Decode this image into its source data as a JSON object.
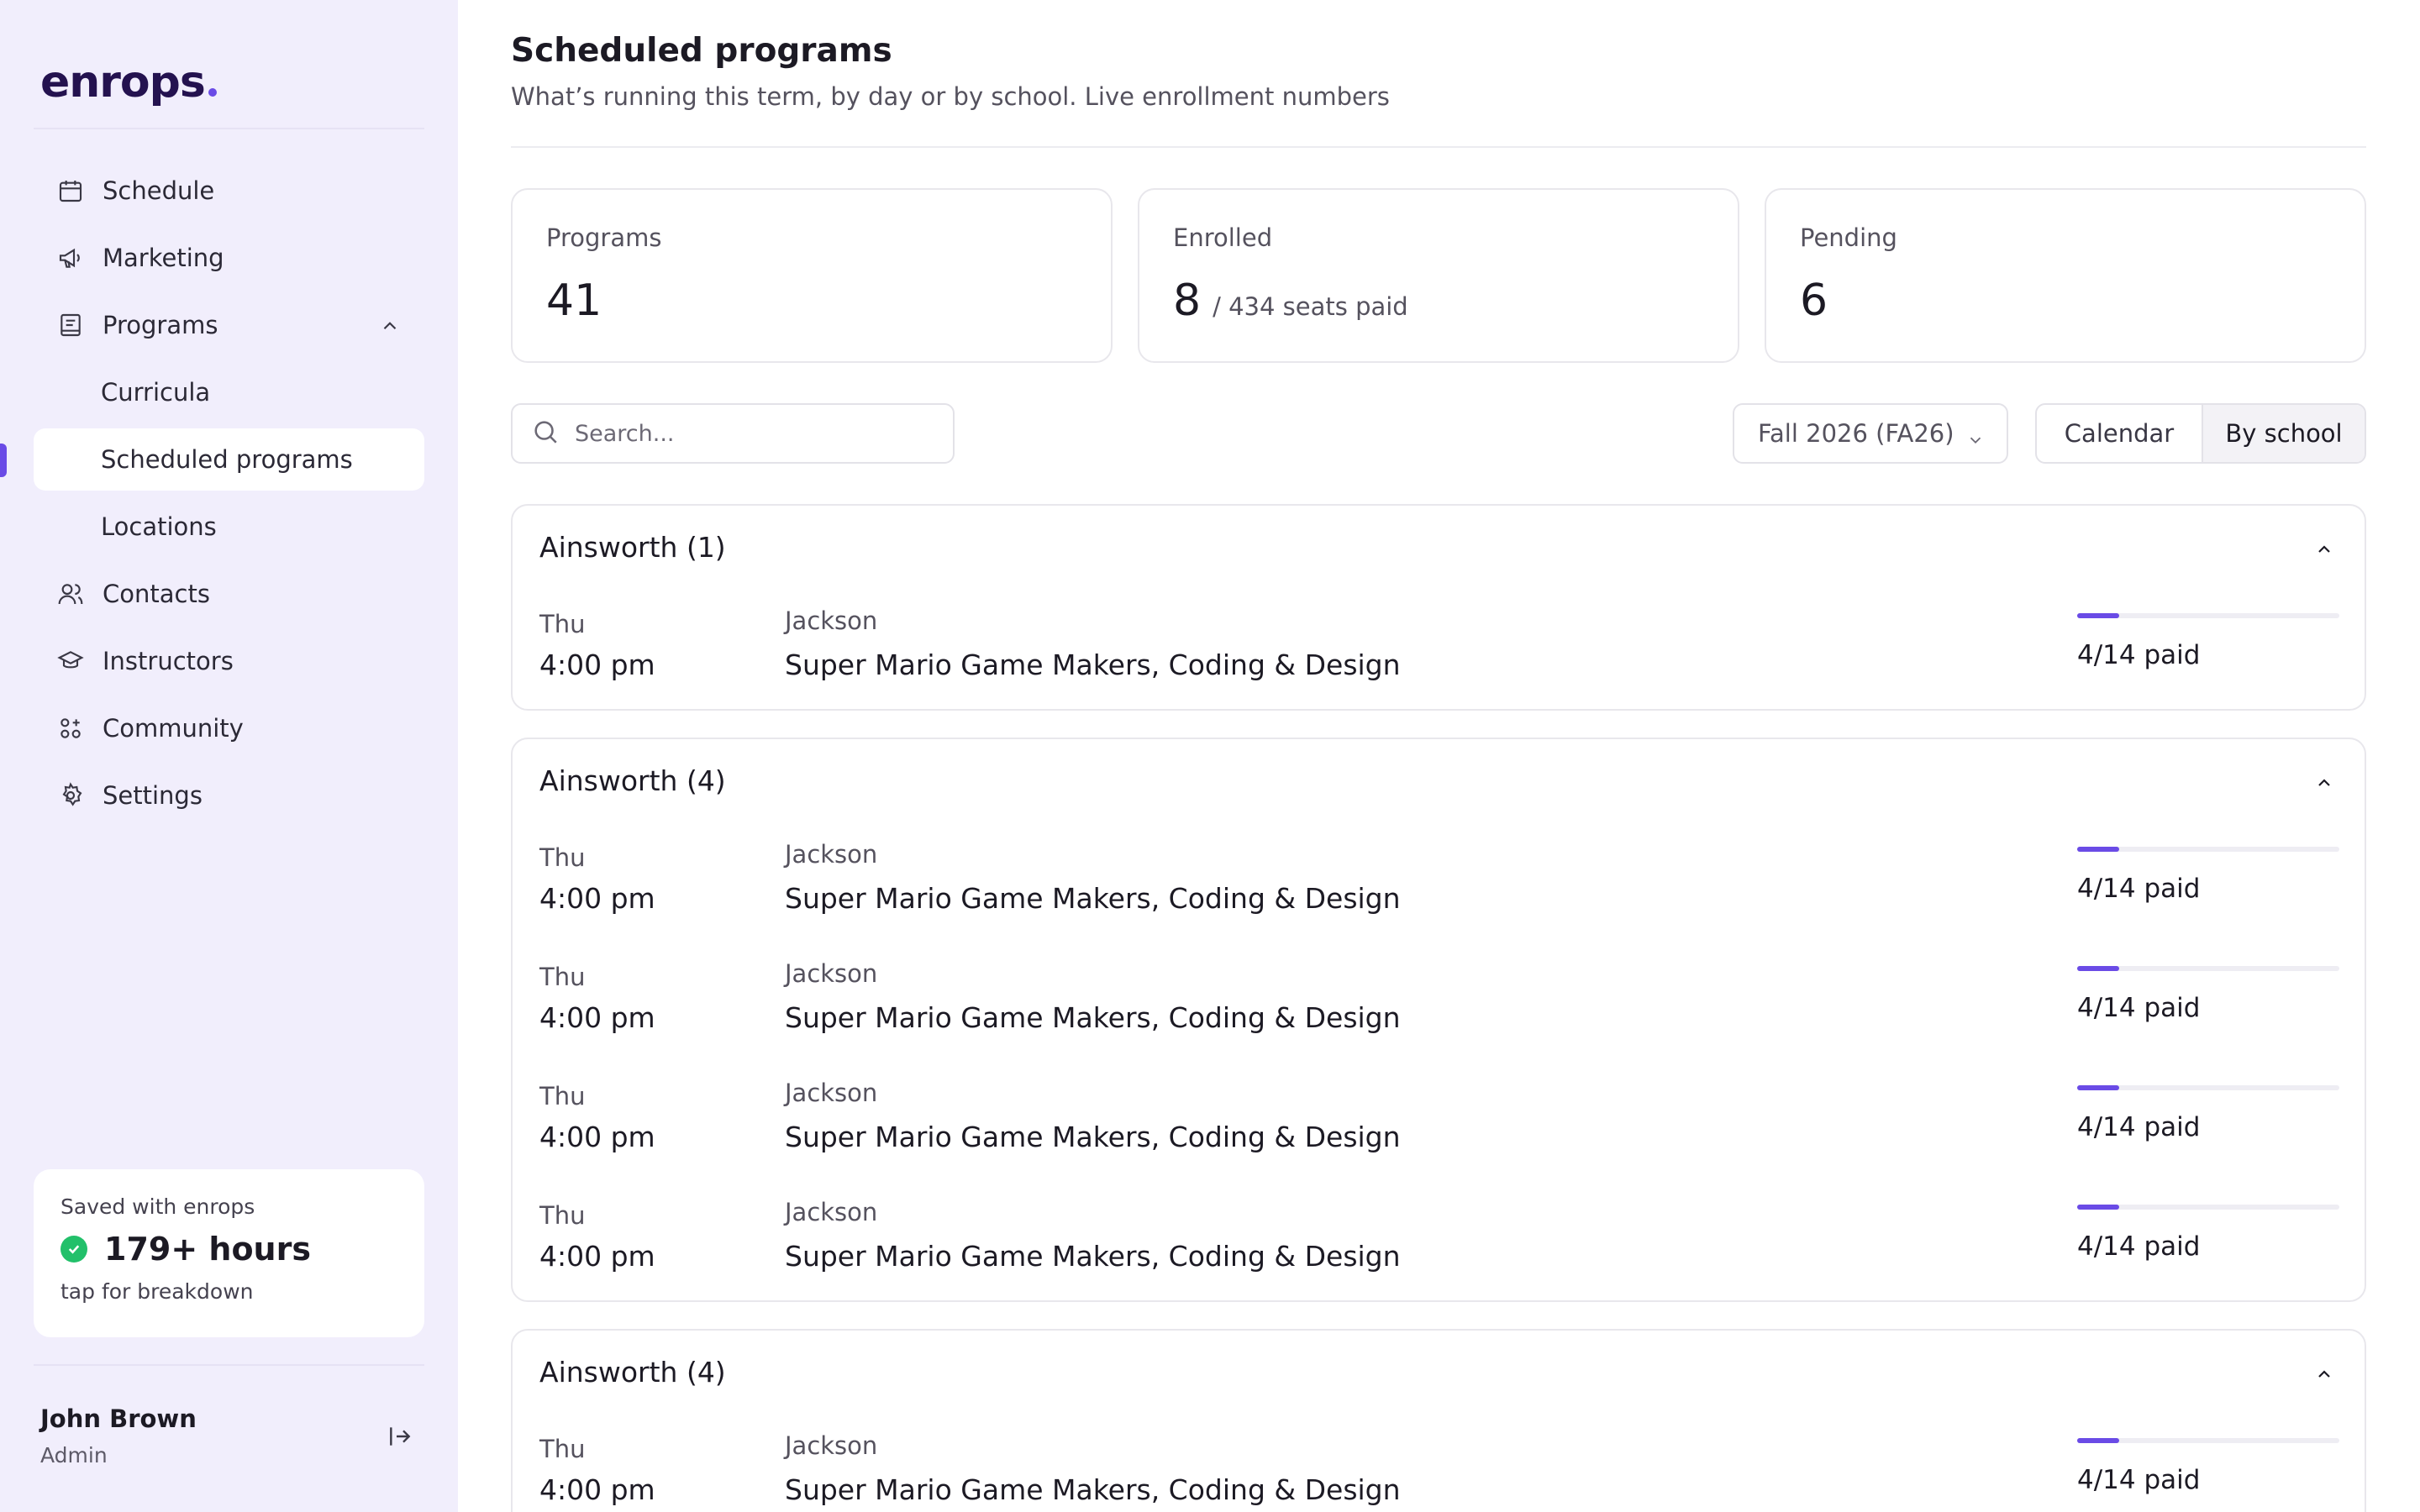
{
  "brand": {
    "name": "enrops",
    "accent": "#6a4be6"
  },
  "sidebar": {
    "nav": [
      {
        "label": "Schedule",
        "icon": "calendar-icon"
      },
      {
        "label": "Marketing",
        "icon": "megaphone-icon"
      },
      {
        "label": "Programs",
        "icon": "book-icon",
        "expanded": true
      },
      {
        "label": "Curricula",
        "sub": true
      },
      {
        "label": "Scheduled programs",
        "sub": true,
        "active": true
      },
      {
        "label": "Locations",
        "sub": true
      },
      {
        "label": "Contacts",
        "icon": "users-icon"
      },
      {
        "label": "Instructors",
        "icon": "graduation-cap-icon"
      },
      {
        "label": "Community",
        "icon": "community-icon"
      },
      {
        "label": "Settings",
        "icon": "gear-icon"
      }
    ],
    "saved": {
      "title": "Saved with enrops",
      "hours": "179+ hours",
      "sub": "tap for breakdown"
    },
    "user": {
      "name": "John Brown",
      "role": "Admin"
    }
  },
  "header": {
    "title": "Scheduled programs",
    "subtitle": "What’s running this term, by day or by school. Live enrollment numbers"
  },
  "stats": [
    {
      "label": "Programs",
      "value": "41",
      "suffix": ""
    },
    {
      "label": "Enrolled",
      "value": "8",
      "suffix": "/ 434 seats paid"
    },
    {
      "label": "Pending",
      "value": "6",
      "suffix": ""
    }
  ],
  "toolbar": {
    "search_placeholder": "Search...",
    "term": "Fall 2026 (FA26)",
    "views": {
      "calendar": "Calendar",
      "by_school": "By school",
      "active": "by_school"
    }
  },
  "groups": [
    {
      "title": "Ainsworth (1)",
      "rows": [
        {
          "day": "Thu",
          "time": "4:00 pm",
          "location": "Jackson",
          "name": "Super Mario Game Makers, Coding & Design",
          "paid": "4/14 paid",
          "paid_fraction": 0.16
        }
      ]
    },
    {
      "title": "Ainsworth (4)",
      "rows": [
        {
          "day": "Thu",
          "time": "4:00 pm",
          "location": "Jackson",
          "name": "Super Mario Game Makers, Coding & Design",
          "paid": "4/14 paid",
          "paid_fraction": 0.16
        },
        {
          "day": "Thu",
          "time": "4:00 pm",
          "location": "Jackson",
          "name": "Super Mario Game Makers, Coding & Design",
          "paid": "4/14 paid",
          "paid_fraction": 0.16
        },
        {
          "day": "Thu",
          "time": "4:00 pm",
          "location": "Jackson",
          "name": "Super Mario Game Makers, Coding & Design",
          "paid": "4/14 paid",
          "paid_fraction": 0.16
        },
        {
          "day": "Thu",
          "time": "4:00 pm",
          "location": "Jackson",
          "name": "Super Mario Game Makers, Coding & Design",
          "paid": "4/14 paid",
          "paid_fraction": 0.16
        }
      ]
    },
    {
      "title": "Ainsworth (4)",
      "rows": [
        {
          "day": "Thu",
          "time": "4:00 pm",
          "location": "Jackson",
          "name": "Super Mario Game Makers, Coding & Design",
          "paid": "4/14 paid",
          "paid_fraction": 0.16
        }
      ]
    }
  ]
}
